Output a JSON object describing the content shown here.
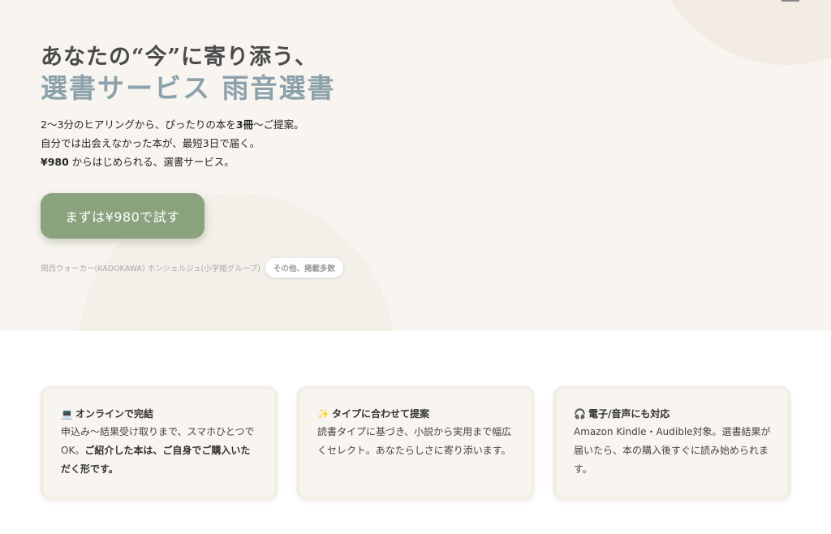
{
  "hero": {
    "headline_line1": "あなたの“今”に寄り添う、",
    "headline_line2": "選書サービス 雨音選書",
    "desc_line1_a": "2〜3分のヒアリングから、ぴったりの本を",
    "desc_line1_b": "3冊",
    "desc_line1_c": "〜ご提案。",
    "desc_line2": "自分では出会えなかった本が、最短3日で届く。",
    "desc_line3_a": "¥980",
    "desc_line3_b": " からはじめられる、選書サービス。",
    "cta_label": "まずは¥980で試す",
    "press_text": "関西ウォーカー(KADOKAWA) ホンシェルジュ(小学館グループ)",
    "press_more": "その他、掲載多数"
  },
  "features": [
    {
      "icon": "laptop-icon",
      "icon_glyph": "💻",
      "title": "オンラインで完結",
      "body_plain": "申込み〜結果受け取りまで、スマホひとつでOK。",
      "body_bold": "ご紹介した本は、ご自身でご購入いただく形です。"
    },
    {
      "icon": "sparkles-icon",
      "icon_glyph": "✨",
      "title": "タイプに合わせて提案",
      "body_plain": "読書タイプに基づき、小説から実用まで幅広くセレクト。あなたらしさに寄り添います。",
      "body_bold": ""
    },
    {
      "icon": "headphones-icon",
      "icon_glyph": "🎧",
      "title": "電子/音声にも対応",
      "body_plain": "Amazon Kindle・Audible対象。選書結果が届いたら、本の購入後すぐに読み始められます。",
      "body_bold": ""
    }
  ],
  "colors": {
    "hero_bg": "#f8f5f0",
    "headline_dark": "#4a4a4a",
    "headline_accent": "#8da1ab",
    "cta_green": "#8aa37e",
    "card_bg": "#f8f5f0"
  }
}
